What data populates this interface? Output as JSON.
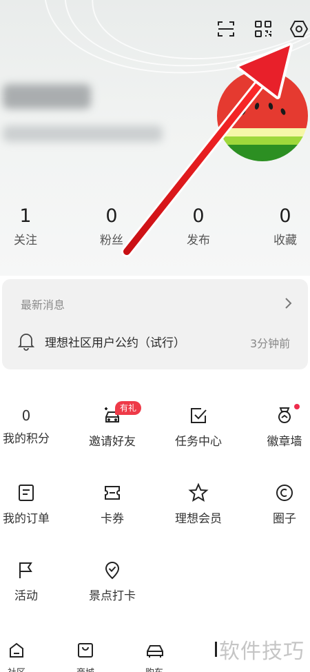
{
  "profile": {
    "username_blurred": "",
    "userid_blurred": ""
  },
  "stats": [
    {
      "value": "1",
      "label": "关注"
    },
    {
      "value": "0",
      "label": "粉丝"
    },
    {
      "value": "0",
      "label": "发布"
    },
    {
      "value": "0",
      "label": "收藏"
    }
  ],
  "messages": {
    "header": "最新消息",
    "item_title": "理想社区用户公约（试行）",
    "item_time": "3分钟前"
  },
  "grid": {
    "points_value": "0",
    "points_label": "我的积分",
    "invite_label": "邀请好友",
    "invite_badge": "有礼",
    "tasks_label": "任务中心",
    "badges_label": "徽章墙",
    "orders_label": "我的订单",
    "coupons_label": "卡券",
    "member_label": "理想会员",
    "circle_label": "圈子",
    "activity_label": "活动",
    "checkin_label": "景点打卡"
  },
  "bottom_nav": [
    {
      "label": "社区",
      "icon": "home-icon"
    },
    {
      "label": "商城",
      "icon": "bag-icon"
    },
    {
      "label": "购车",
      "icon": "car-icon"
    }
  ],
  "watermark": "软件技巧",
  "colors": {
    "accent_red": "#e8202a",
    "badge_red": "#ee3a48",
    "watermelon_red": "#e53a30",
    "watermelon_green": "#2c8f22"
  }
}
